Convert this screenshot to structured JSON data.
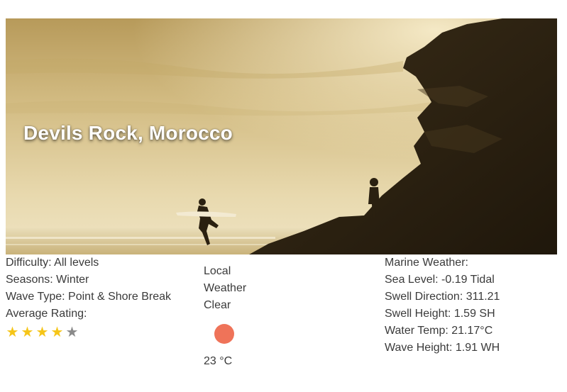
{
  "hero": {
    "title": "Devils Rock, Morocco",
    "image": "surf-spot-photo"
  },
  "details": {
    "difficulty": "Difficulty: All levels",
    "seasons": "Seasons: Winter",
    "wave_type": "Wave Type: Point & Shore Break",
    "average_rating_label": "Average Rating:",
    "rating": 4,
    "rating_max": 5,
    "star_filled_color": "#f5c518",
    "star_empty_color": "#8a8a8a"
  },
  "local_weather": {
    "line1": "Local",
    "line2": "Weather",
    "condition": "Clear",
    "icon": "sun-icon",
    "icon_color": "#ef7359",
    "temperature": "23 °C"
  },
  "marine_weather": {
    "heading": "Marine Weather:",
    "sea_level": "Sea Level: -0.19 Tidal",
    "swell_direction": "Swell Direction: 311.21",
    "swell_height": "Swell Height: 1.59 SH",
    "water_temp": "Water Temp: 21.17°C",
    "wave_height": "Wave Height: 1.91 WH"
  }
}
